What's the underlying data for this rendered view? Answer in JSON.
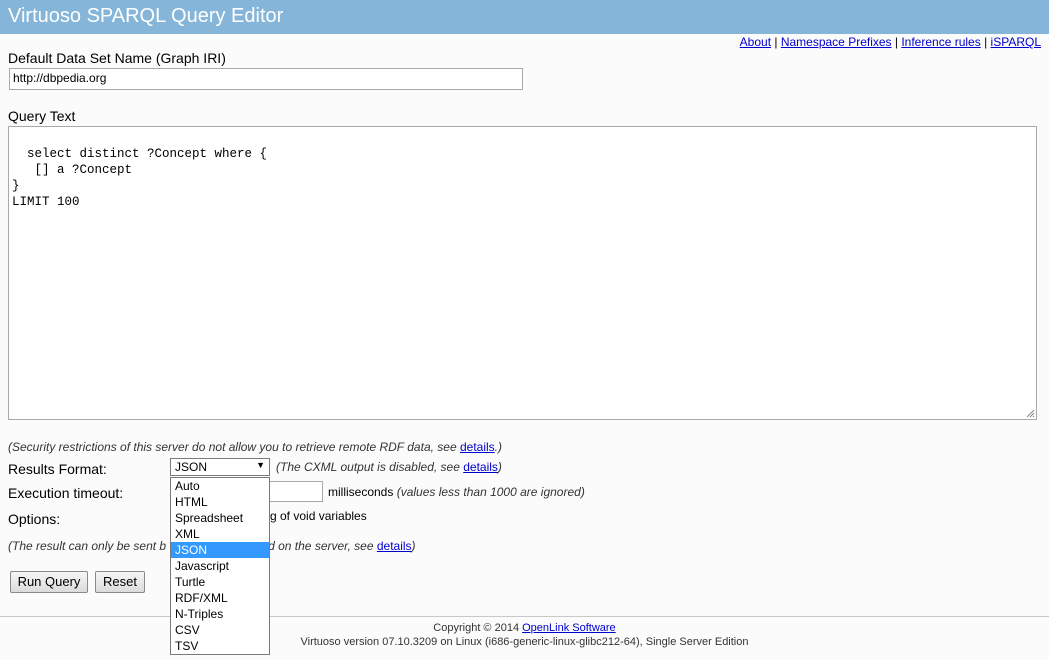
{
  "app": {
    "title": "Virtuoso SPARQL Query Editor"
  },
  "toplinks": [
    {
      "label": "About"
    },
    {
      "label": "Namespace Prefixes"
    },
    {
      "label": "Inference rules"
    },
    {
      "label": "iSPARQL"
    }
  ],
  "graph": {
    "label": "Default Data Set Name (Graph IRI)",
    "value": "http://dbpedia.org"
  },
  "query": {
    "label": "Query Text",
    "text": "select distinct ?Concept where {\n   [] a ?Concept\n}\nLIMIT 100"
  },
  "security_note": {
    "text": "(Security restrictions of this server do not allow you to retrieve remote RDF data, see ",
    "link": "details",
    "end": ".)"
  },
  "results_format": {
    "label": "Results Format:",
    "selected": "JSON",
    "note": "(The CXML output is disabled, see ",
    "link": "details",
    "end": ")",
    "options": [
      "Auto",
      "HTML",
      "Spreadsheet",
      "XML",
      "JSON",
      "Javascript",
      "Turtle",
      "RDF/XML",
      "N-Triples",
      "CSV",
      "TSV"
    ]
  },
  "timeout": {
    "label": "Execution timeout:",
    "value": "",
    "unit": "milliseconds",
    "note": "(values less than 1000 are ignored)"
  },
  "options": {
    "label": "Options:",
    "partial_text": "g of void variables"
  },
  "result_note": {
    "start": "(The result can only be sent b",
    "rest": "t saved on the server, see ",
    "link": "details",
    "end": ")"
  },
  "buttons": {
    "run": "Run Query",
    "reset": "Reset"
  },
  "footer": {
    "copyright": "Copyright © 2014 ",
    "company": "OpenLink Software",
    "version": "Virtuoso version 07.10.3209 on Linux (i686-generic-linux-glibc212-64), Single Server Edition"
  }
}
